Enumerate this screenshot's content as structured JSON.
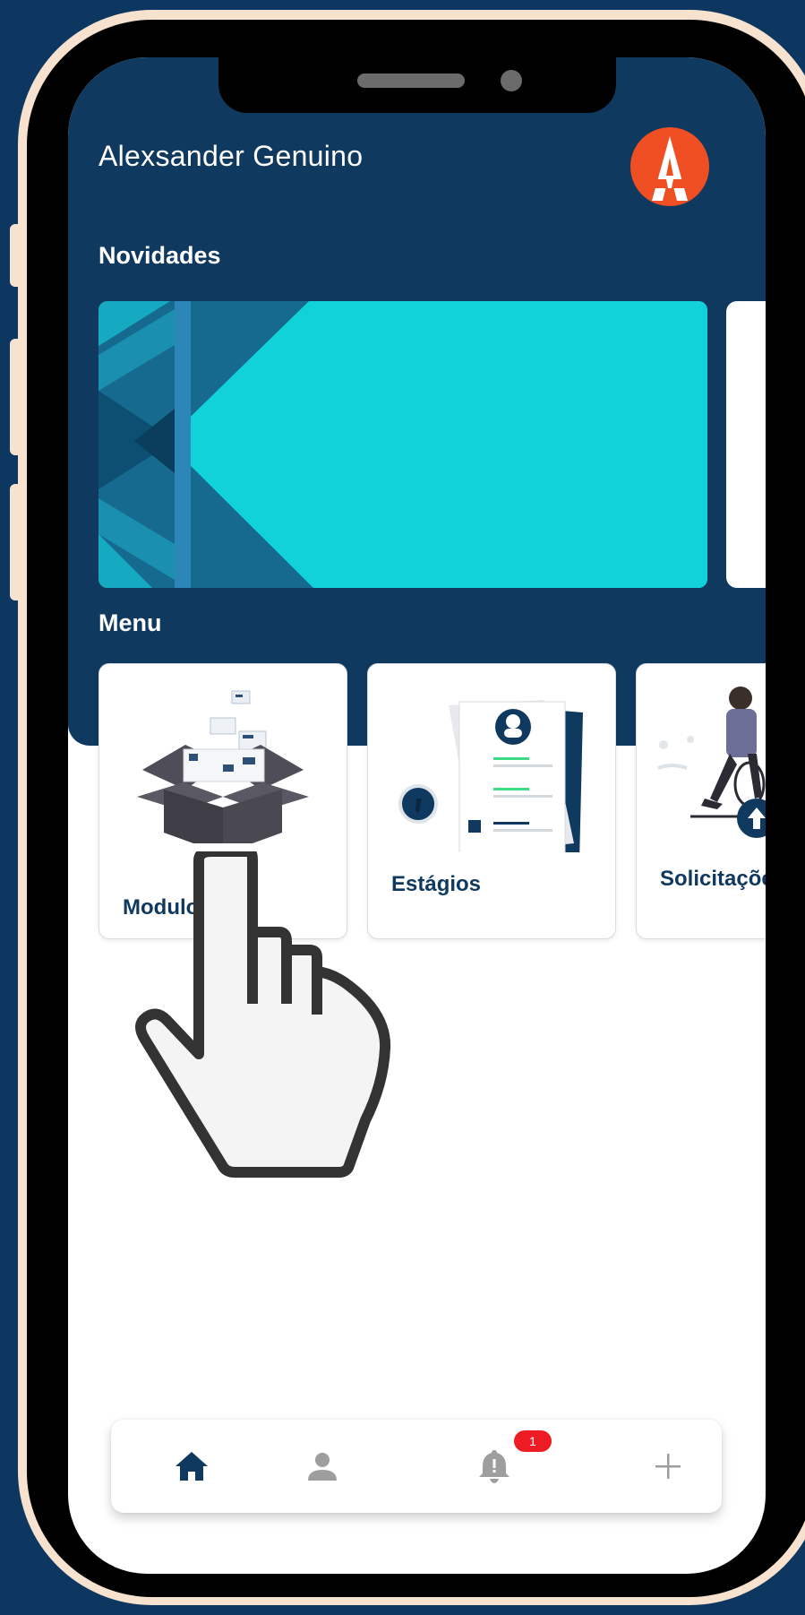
{
  "header": {
    "user_name": "Alexsander Genuino",
    "logo_letter": "A",
    "brand_color": "#f04e23"
  },
  "novidades": {
    "title": "Novidades",
    "banner_color": "#10d2d8"
  },
  "menu": {
    "title": "Menu",
    "items": [
      {
        "label": "Modulos"
      },
      {
        "label": "Estágios"
      },
      {
        "label": "Solicitações"
      }
    ]
  },
  "bottom_nav": {
    "items": [
      {
        "icon": "home-icon",
        "active": true
      },
      {
        "icon": "person-icon",
        "active": false
      },
      {
        "icon": "bell-icon",
        "active": false
      },
      {
        "icon": "plus-icon",
        "active": false
      }
    ],
    "notification_count": "1",
    "active_color": "#10395f",
    "inactive_color": "#9e9e9e"
  },
  "colors": {
    "background": "#0d3660",
    "header": "#10395f",
    "frame": "#f6e2cf"
  }
}
